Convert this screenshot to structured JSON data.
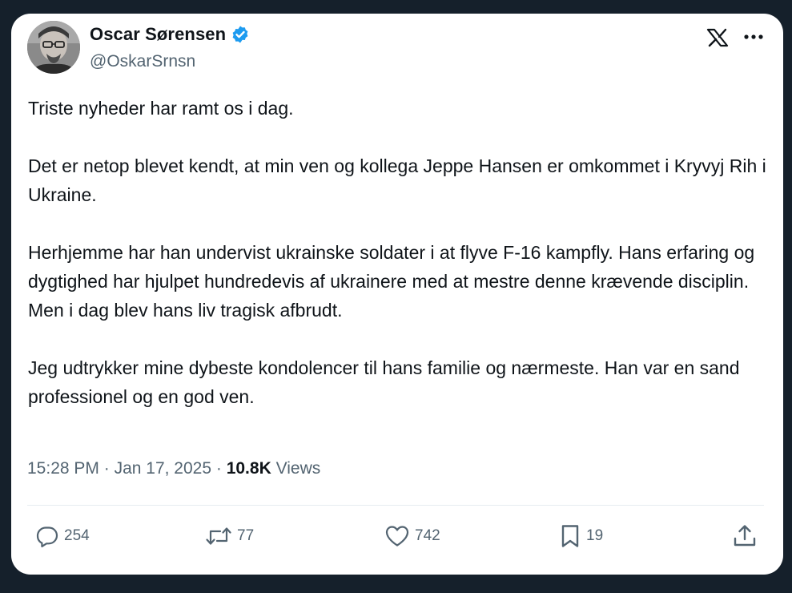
{
  "author": {
    "display_name": "Oscar Sørensen",
    "handle": "@OskarSrnsn",
    "verified": true,
    "verified_color": "#1d9bf0"
  },
  "header_icons": {
    "logo": "x-logo-icon",
    "menu": "more-horizontal-icon"
  },
  "tweet": {
    "paragraphs": [
      "Triste nyheder har ramt os i dag.",
      "Det er netop blevet kendt, at min ven og kollega Jeppe Hansen er omkommet i Kryvyj Rih i Ukraine.",
      "Herhjemme har han undervist ukrainske soldater i at flyve F-16 kampfly. Hans erfaring og dygtighed har hjulpet hundredevis af ukrainere med at mestre denne krævende disciplin. Men i dag blev hans liv tragisk afbrudt.",
      "Jeg udtrykker mine dybeste kondolencer til hans familie og nærmeste. Han var en sand professionel og en god ven."
    ]
  },
  "meta": {
    "time": "15:28 PM",
    "separator": "·",
    "date": "Jan 17, 2025",
    "views_count": "10.8K",
    "views_label": "Views"
  },
  "actions": {
    "reply": {
      "icon": "reply-icon",
      "count": "254"
    },
    "repost": {
      "icon": "repost-icon",
      "count": "77"
    },
    "like": {
      "icon": "heart-icon",
      "count": "742"
    },
    "bookmark": {
      "icon": "bookmark-icon",
      "count": "19"
    },
    "share": {
      "icon": "share-icon"
    }
  },
  "colors": {
    "background": "#15202b",
    "card": "#ffffff",
    "text_primary": "#0f1419",
    "text_secondary": "#536471"
  }
}
